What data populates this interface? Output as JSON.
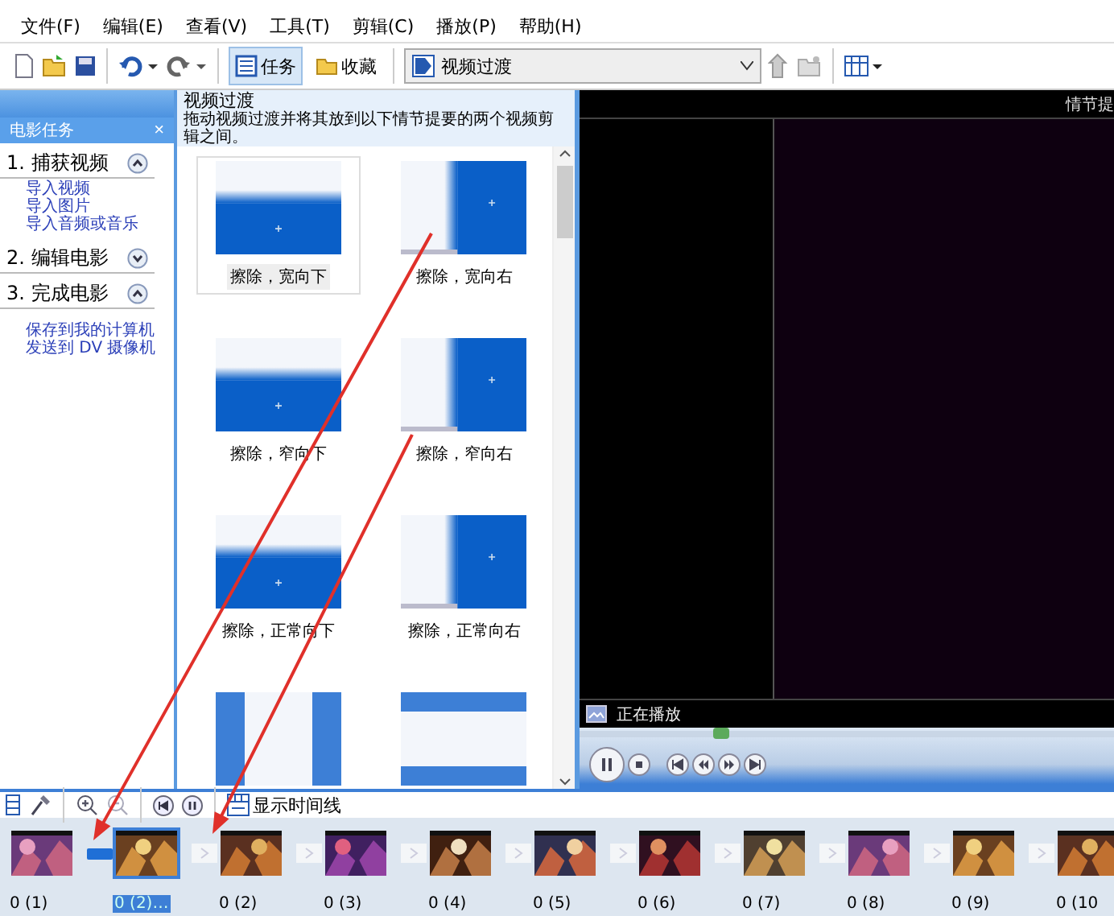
{
  "menu": [
    "文件(F)",
    "编辑(E)",
    "查看(V)",
    "工具(T)",
    "剪辑(C)",
    "播放(P)",
    "帮助(H)"
  ],
  "toolbar": {
    "tasks": {
      "label": "任务",
      "selected": true
    },
    "favorites": {
      "label": "收藏",
      "selected": false
    },
    "collection": "视频过渡"
  },
  "task_pane": {
    "title": "电影任务",
    "close": "×",
    "sections": [
      {
        "label": "1. 捕获视频",
        "expanded": true,
        "links": [
          "导入视频",
          "导入图片",
          "导入音频或音乐"
        ]
      },
      {
        "label": "2. 编辑电影",
        "expanded": false
      },
      {
        "label": "3. 完成电影",
        "expanded": true,
        "links": [
          "保存到我的计算机",
          "发送到 DV 摄像机"
        ]
      }
    ]
  },
  "transitions": {
    "title": "视频过渡",
    "description": "拖动视频过渡并将其放到以下情节提要的两个视频剪辑之间。",
    "items": [
      {
        "kind": "wipe-down",
        "label": "擦除，宽向下",
        "selected": true
      },
      {
        "kind": "wipe-right",
        "label": "擦除，宽向右",
        "selected": false
      },
      {
        "kind": "wipe-down",
        "label": "擦除，窄向下",
        "selected": false
      },
      {
        "kind": "wipe-right",
        "label": "擦除，窄向右",
        "selected": false
      },
      {
        "kind": "wipe-down",
        "label": "擦除，正常向下",
        "selected": false
      },
      {
        "kind": "wipe-right",
        "label": "擦除，正常向右",
        "selected": false
      },
      {
        "kind": "split-v",
        "selected": false
      },
      {
        "kind": "split-h",
        "selected": false
      }
    ]
  },
  "preview": {
    "header": "情节提",
    "status": "正在播放",
    "seek": {
      "level": 0.25
    }
  },
  "storyboard": {
    "timeline_button": "显示时间线",
    "clips": [
      {
        "label": "0 (1)",
        "selected": false
      },
      {
        "label": "0 (2)…",
        "selected": true
      },
      {
        "label": "0 (2)",
        "selected": false
      },
      {
        "label": "0 (3)",
        "selected": false
      },
      {
        "label": "0 (4)",
        "selected": false
      },
      {
        "label": "0 (5)",
        "selected": false
      },
      {
        "label": "0 (6)",
        "selected": false
      },
      {
        "label": "0 (7)",
        "selected": false
      },
      {
        "label": "0 (8)",
        "selected": false
      },
      {
        "label": "0 (9)",
        "selected": false
      },
      {
        "label": "0 (10",
        "selected": false
      }
    ],
    "transition_slots": [
      {
        "filled": true
      },
      {
        "filled": false
      },
      {
        "filled": false
      },
      {
        "filled": false
      },
      {
        "filled": false
      },
      {
        "filled": false
      },
      {
        "filled": false
      },
      {
        "filled": false
      },
      {
        "filled": false
      },
      {
        "filled": false
      }
    ]
  }
}
